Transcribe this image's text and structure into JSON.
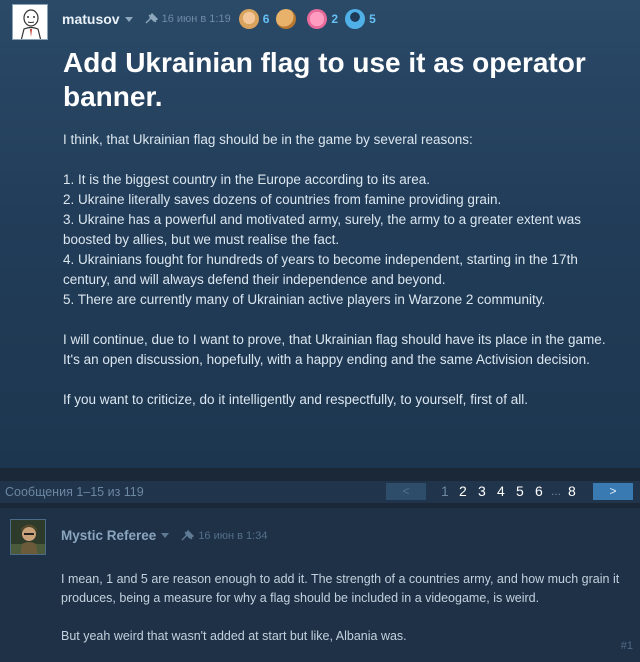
{
  "op": {
    "author": "matusov",
    "date": "16 июн в 1:19",
    "badges": [
      {
        "icon": "baby-badge-icon",
        "count": "6",
        "color": "#d9a35d"
      },
      {
        "icon": "cookie-badge-icon",
        "count": "",
        "color": "#c98b3e"
      },
      {
        "icon": "piggy-badge-icon",
        "count": "2",
        "color": "#e66a9a"
      },
      {
        "icon": "medal-badge-icon",
        "count": "5",
        "color": "#4fb1e8"
      }
    ],
    "title": "Add Ukrainian flag to use it as operator banner.",
    "paragraphs": {
      "intro": "I think, that Ukrainian flag should be in the game by several reasons:",
      "r1": "1. It is the biggest country in the Europe according to its area.",
      "r2": "2. Ukraine literally saves dozens of countries from famine providing grain.",
      "r3": "3. Ukraine has a powerful and motivated army, surely, the army to a greater extent was boosted by allies, but we must realise the fact.",
      "r4": "4. Ukrainians fought for hundreds of years to become independent, starting in the 17th century, and will always defend their independence and beyond.",
      "r5": "5. There are currently many of Ukrainian active players in Warzone 2 community.",
      "p1": "I will continue, due to I want to prove, that Ukrainian flag should have its place in the game.",
      "p2": "It's an open discussion, hopefully, with a happy ending and the same Activision decision.",
      "p3": "If you want to criticize, do it intelligently and respectfully, to yourself, first of all."
    }
  },
  "pagination": {
    "summary": "Сообщения 1–15 из 119",
    "prev": "<",
    "next": ">",
    "pages": [
      "1",
      "2",
      "3",
      "4",
      "5",
      "6",
      "8"
    ],
    "current_page": "1",
    "dots": "..."
  },
  "reply": {
    "author": "Mystic Referee",
    "date": "16 июн в 1:34",
    "paragraphs": {
      "p1": "I mean, 1 and 5 are reason enough to add it. The strength of a countries army, and how much grain it produces, being a measure for why a flag should be included in a videogame, is weird.",
      "p2": "But yeah weird that wasn't added at start but like, Albania was."
    },
    "post_number": "#1"
  },
  "colors": {
    "background": "#1b2838",
    "accent": "#66c0f4",
    "next_button": "#3a7ab3"
  }
}
